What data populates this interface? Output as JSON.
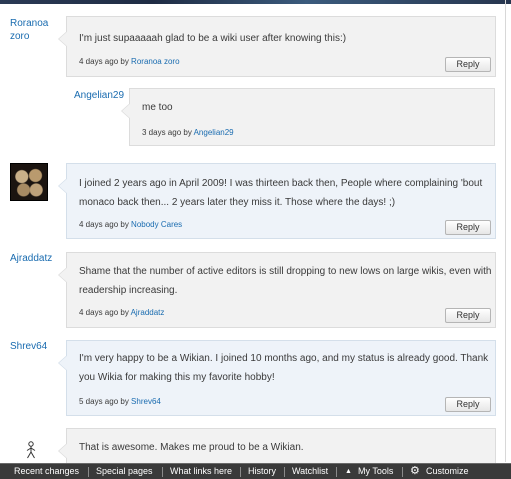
{
  "comments": [
    {
      "author": "Roranoa zoro",
      "author_lines": [
        "Roranoa",
        "zoro"
      ],
      "text_lines": [
        "I'm just supaaaaah glad to be a wiki user after knowing this:)"
      ],
      "time": "4 days ago by",
      "by": "Roranoa zoro",
      "reply_label": "Reply"
    },
    {
      "author": "Angelian29",
      "text_lines": [
        "me too"
      ],
      "time": "3 days ago by",
      "by": "Angelian29"
    },
    {
      "author": "Nobody Cares",
      "avatar": "album-cover-avatar",
      "text_lines": [
        "I joined 2 years ago in April 2009! I was thirteen back then, People where complaining 'bout",
        "monaco back then... 2 years later they miss it. Those where the days! ;)"
      ],
      "time": "4 days ago by",
      "by": "Nobody Cares",
      "reply_label": "Reply"
    },
    {
      "author": "Ajraddatz",
      "text_lines": [
        "Shame that the number of active editors is still dropping to new lows on large wikis, even with",
        "readership increasing."
      ],
      "time": "4 days ago by",
      "by": "Ajraddatz",
      "reply_label": "Reply"
    },
    {
      "author": "Shrev64",
      "text_lines": [
        "I'm very happy to be a Wikian. I joined 10 months ago, and my status is already good. Thank",
        "you Wikia for making this my favorite hobby!"
      ],
      "time": "5 days ago by",
      "by": "Shrev64",
      "reply_label": "Reply"
    },
    {
      "avatar": "stick-figure-avatar",
      "text_lines": [
        "That is awesome. Makes me proud to be a Wikian."
      ]
    }
  ],
  "toolbar": {
    "items": [
      "Recent changes",
      "Special pages",
      "What links here",
      "History",
      "Watchlist",
      "My Tools",
      "Customize"
    ],
    "icons": {
      "menu": "up-arrow-icon",
      "customize": "gear-icon"
    }
  },
  "colors": {
    "link": "#1a6cb0",
    "toolbar_bg": "#3a3a3a",
    "bubble_blue": "#eef3f9",
    "bubble_gray": "#f2f2f2"
  }
}
